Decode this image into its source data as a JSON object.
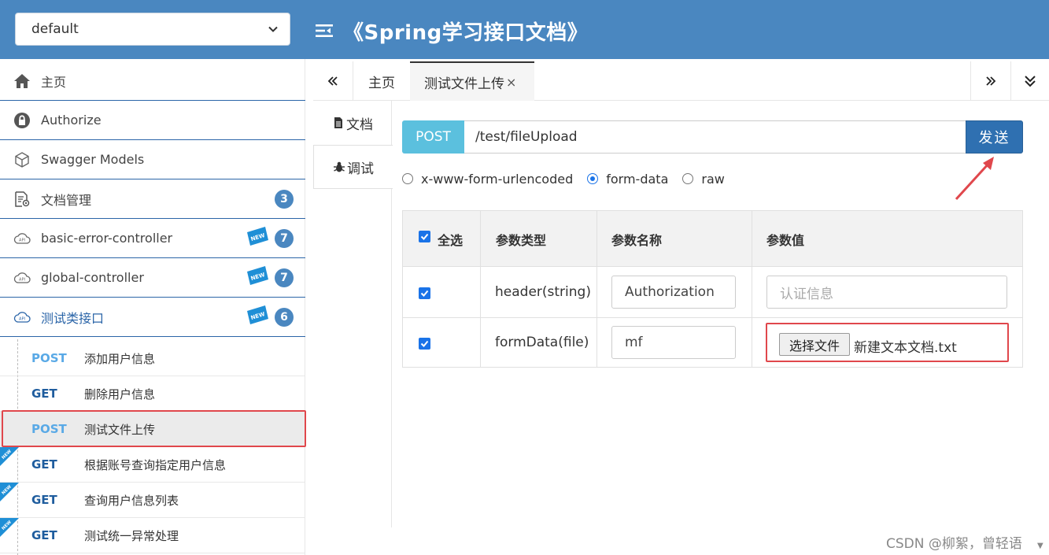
{
  "header": {
    "group_select": "default",
    "title": "《Spring学习接口文档》"
  },
  "sidebar": {
    "items": [
      {
        "label": "主页",
        "icon": "home-icon"
      },
      {
        "label": "Authorize",
        "icon": "lock-icon"
      },
      {
        "label": "Swagger Models",
        "icon": "cube-icon"
      },
      {
        "label": "文档管理",
        "icon": "doc-settings-icon",
        "count": "3"
      },
      {
        "label": "basic-error-controller",
        "icon": "cloud-api-icon",
        "count": "7",
        "new": "NEW"
      },
      {
        "label": "global-controller",
        "icon": "cloud-api-icon",
        "count": "7",
        "new": "NEW"
      },
      {
        "label": "测试类接口",
        "icon": "cloud-api-icon",
        "count": "6",
        "new": "NEW"
      }
    ],
    "endpoints": [
      {
        "method": "POST",
        "name": "添加用户信息"
      },
      {
        "method": "GET",
        "name": "删除用户信息"
      },
      {
        "method": "POST",
        "name": "测试文件上传"
      },
      {
        "method": "GET",
        "name": "根据账号查询指定用户信息"
      },
      {
        "method": "GET",
        "name": "查询用户信息列表"
      },
      {
        "method": "GET",
        "name": "测试统一异常处理"
      }
    ]
  },
  "tabs": {
    "prev": "«",
    "next": "»",
    "items": [
      {
        "label": "主页"
      },
      {
        "label": "测试文件上传",
        "close": "×"
      }
    ]
  },
  "vtabs": {
    "doc": "文档",
    "debug": "调试"
  },
  "request": {
    "method": "POST",
    "url": "/test/fileUpload",
    "send_label": "发送",
    "content_types": [
      "x-www-form-urlencoded",
      "form-data",
      "raw"
    ],
    "selected_content_type": "form-data"
  },
  "params": {
    "headers": [
      "全选",
      "参数类型",
      "参数名称",
      "参数值"
    ],
    "rows": [
      {
        "type": "header(string)",
        "name": "Authorization",
        "value_placeholder": "认证信息"
      },
      {
        "type": "formData(file)",
        "name": "mf",
        "file_button": "选择文件",
        "file_name": "新建文本文档.txt"
      }
    ]
  },
  "watermark": "CSDN @柳絮，曾轻语",
  "colors": {
    "header_bg": "#4a87c0",
    "post": "#5bc0de",
    "send": "#2f70b1",
    "highlight": "#e0474c"
  }
}
